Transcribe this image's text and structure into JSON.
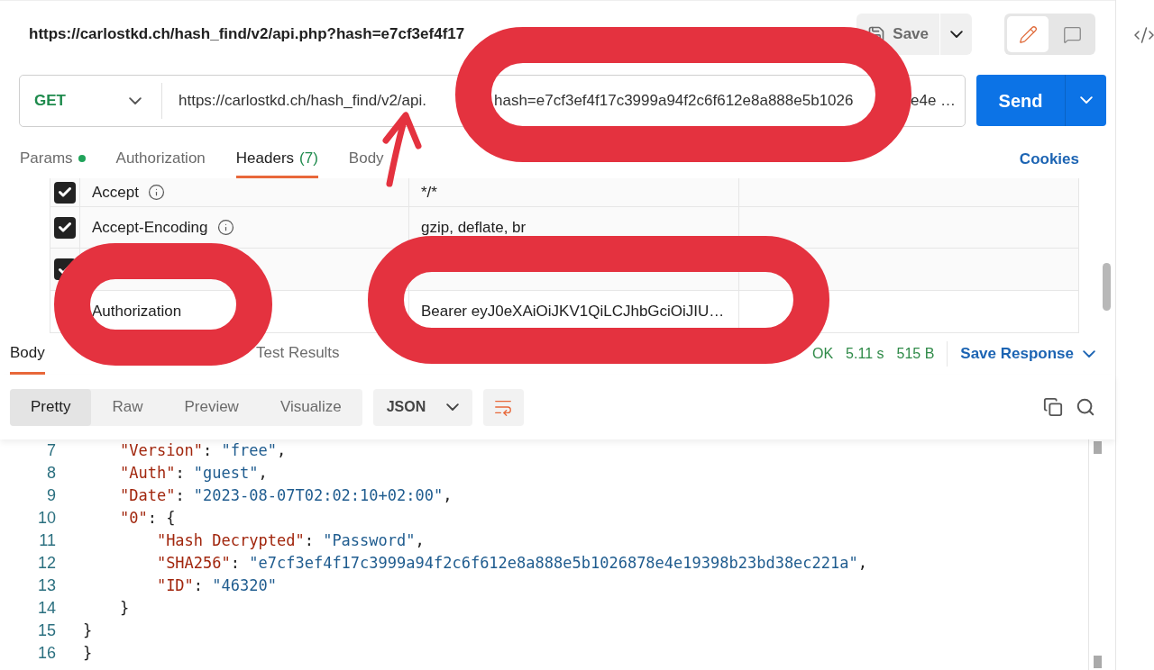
{
  "request_title": "https://carlostkd.ch/hash_find/v2/api.php?hash=e7cf3ef4f17",
  "save_button": {
    "label": "Save"
  },
  "mode_toggle": [
    {
      "kind": "edit",
      "selected": true
    },
    {
      "kind": "comments",
      "selected": false
    }
  ],
  "url_bar": {
    "method": "GET",
    "url_parts": [
      "https://carlostkd.ch/hash_find/v2/api.",
      "hash=e7cf3ef4f17c3999a94f2c6f612e8a888e5b1026",
      "e4e …"
    ]
  },
  "send_button": {
    "label": "Send"
  },
  "request_tabs": [
    {
      "label": "Params",
      "has_values": true,
      "selected": false
    },
    {
      "label": "Authorization",
      "selected": false
    },
    {
      "label": "Headers",
      "count": "(7)",
      "selected": true
    },
    {
      "label": "Body",
      "selected": false
    }
  ],
  "cookies_link": "Cookies",
  "headers": [
    {
      "key": "Accept",
      "info": true,
      "value": "*/*",
      "checked": true
    },
    {
      "key": "Accept-Encoding",
      "info": true,
      "value": "gzip, deflate, br",
      "checked": true
    },
    {
      "checked": true
    },
    {
      "key": "Authorization",
      "value": "Bearer eyJ0eXAiOiJKV1QiLCJhbGciOiJIU…"
    }
  ],
  "response": {
    "tabs": [
      {
        "label": "Body",
        "selected": true
      },
      {
        "label": "Test Results",
        "selected": false
      }
    ],
    "status": "OK",
    "time": "5.11 s",
    "size": "515 B",
    "save_response": "Save Response",
    "views": [
      {
        "label": "Pretty",
        "selected": true
      },
      {
        "label": "Raw",
        "selected": false
      },
      {
        "label": "Preview",
        "selected": false
      },
      {
        "label": "Visualize",
        "selected": false
      }
    ],
    "format": "JSON",
    "code_lines": [
      {
        "number": "7",
        "text": "    \"Version\": \"free\","
      },
      {
        "number": "8",
        "text": "    \"Auth\": \"guest\","
      },
      {
        "number": "9",
        "text": "    \"Date\": \"2023-08-07T02:02:10+02:00\","
      },
      {
        "number": "10",
        "text": "    \"0\": {"
      },
      {
        "number": "11",
        "text": "        \"Hash Decrypted\": \"Password\","
      },
      {
        "number": "12",
        "text": "        \"SHA256\": \"e7cf3ef4f17c3999a94f2c6f612e8a888e5b1026878e4e19398b23bd38ec221a\","
      },
      {
        "number": "13",
        "text": "        \"ID\": \"46320\""
      },
      {
        "number": "14",
        "text": "    }"
      },
      {
        "number": "15",
        "text": "}"
      },
      {
        "number": "16",
        "text": "}"
      }
    ]
  }
}
